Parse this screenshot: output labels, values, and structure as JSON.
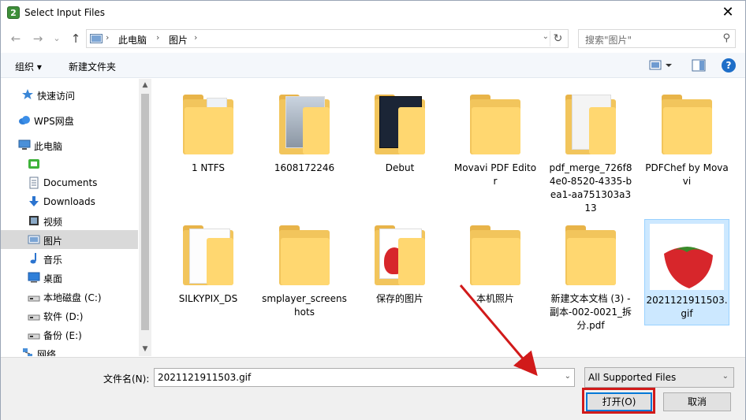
{
  "window": {
    "title": "Select Input Files",
    "app_icon_glyph": "2",
    "close_glyph": "✕"
  },
  "nav": {
    "back_glyph": "←",
    "forward_glyph": "→",
    "recent_glyph": "⌄",
    "up_glyph": "↑",
    "path": [
      "此电脑",
      "图片"
    ],
    "path_sep": "›",
    "dropdown_glyph": "⌄",
    "refresh_glyph": "↻"
  },
  "search": {
    "placeholder": "搜索\"图片\"",
    "icon": "search-icon",
    "glyph": "⚲"
  },
  "toolbar": {
    "organize_label": "组织 ▾",
    "new_folder_label": "新建文件夹",
    "help_glyph": "?"
  },
  "sidebar": {
    "items": [
      {
        "label": "快速访问",
        "icon": "star-icon"
      },
      {
        "label": "WPS网盘",
        "icon": "cloud-icon"
      },
      {
        "label": "此电脑",
        "icon": "computer-icon"
      },
      {
        "label": "",
        "icon": "drive-green-icon"
      },
      {
        "label": "Documents",
        "icon": "documents-icon"
      },
      {
        "label": "Downloads",
        "icon": "downloads-icon"
      },
      {
        "label": "视频",
        "icon": "video-icon"
      },
      {
        "label": "图片",
        "icon": "pictures-icon"
      },
      {
        "label": "音乐",
        "icon": "music-icon"
      },
      {
        "label": "桌面",
        "icon": "desktop-icon"
      },
      {
        "label": "本地磁盘 (C:)",
        "icon": "disk-icon"
      },
      {
        "label": "软件 (D:)",
        "icon": "disk-icon"
      },
      {
        "label": "备份 (E:)",
        "icon": "disk-icon"
      },
      {
        "label": "网络",
        "icon": "network-icon"
      }
    ],
    "scroll_up_glyph": "▲",
    "scroll_down_glyph": "▼"
  },
  "files": [
    {
      "label": "1 NTFS"
    },
    {
      "label": "1608172246"
    },
    {
      "label": "Debut"
    },
    {
      "label": "Movavi PDF Editor"
    },
    {
      "label": "pdf_merge_726f84e0-8520-4335-bea1-aa751303a313"
    },
    {
      "label": "PDFChef by Movavi"
    },
    {
      "label": "SILKYPIX_DS"
    },
    {
      "label": "smplayer_screenshots"
    },
    {
      "label": "保存的图片"
    },
    {
      "label": "本机照片"
    },
    {
      "label": "新建文本文档 (3) - 副本-002-0021_拆分.pdf"
    },
    {
      "label": "2021121911503.gif"
    }
  ],
  "bottom": {
    "filename_label": "文件名(N):",
    "filename_value": "2021121911503.gif",
    "filetype_value": "All Supported Files",
    "open_label": "打开(O)",
    "cancel_label": "取消"
  },
  "colors": {
    "accent": "#0078d7",
    "selection": "#cce8ff",
    "highlight_red": "#d11a1a",
    "folder": "#ffd770"
  }
}
